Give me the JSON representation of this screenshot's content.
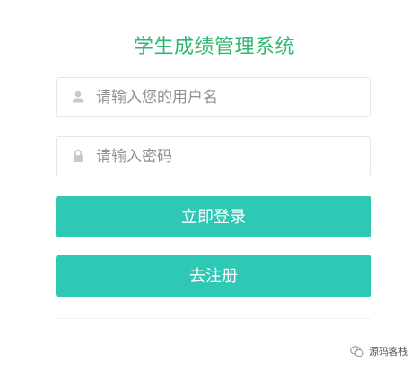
{
  "app": {
    "title": "学生成绩管理系统"
  },
  "login_form": {
    "username": {
      "placeholder": "请输入您的用户名",
      "value": "",
      "icon": "user-icon"
    },
    "password": {
      "placeholder": "请输入密码",
      "value": "",
      "icon": "lock-icon"
    },
    "login_button_label": "立即登录",
    "register_button_label": "去注册"
  },
  "watermark": {
    "text": "源码客栈",
    "icon": "wechat-icon"
  },
  "colors": {
    "title": "#2fb872",
    "button": "#2ec8b5",
    "border": "#e4e6ea",
    "icon": "#c7c9cc"
  }
}
